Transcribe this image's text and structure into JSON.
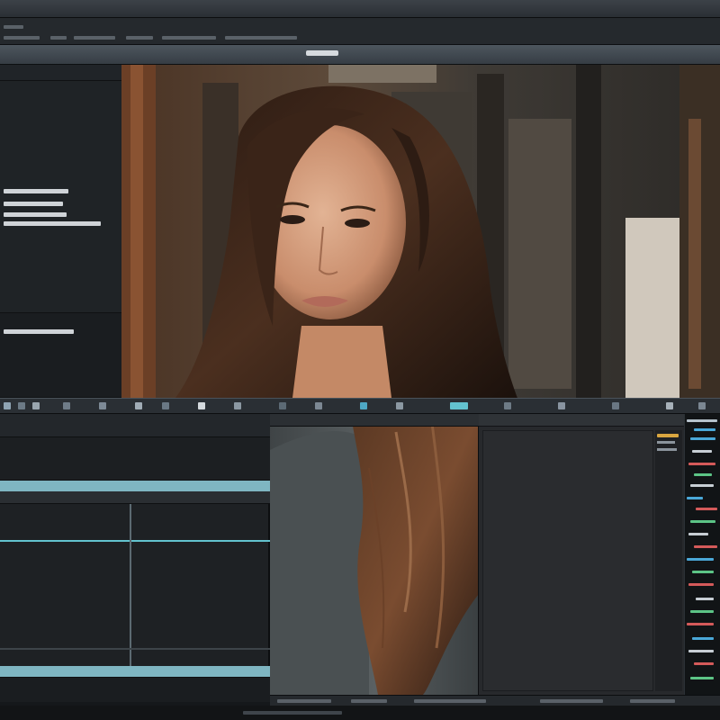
{
  "window": {
    "title": ""
  },
  "left_panel": {
    "lines": []
  },
  "timeline": {
    "header_text": "",
    "footer_text": ""
  },
  "inspector": {
    "header_text": ""
  },
  "colors": {
    "accent_cyan": "#63c3cf",
    "panel_dark": "#1e2124",
    "toolbar": "#2a2f34",
    "highlight_amber": "#d9a640"
  },
  "icons": [
    "toolbar-icons",
    "panel-grip"
  ]
}
